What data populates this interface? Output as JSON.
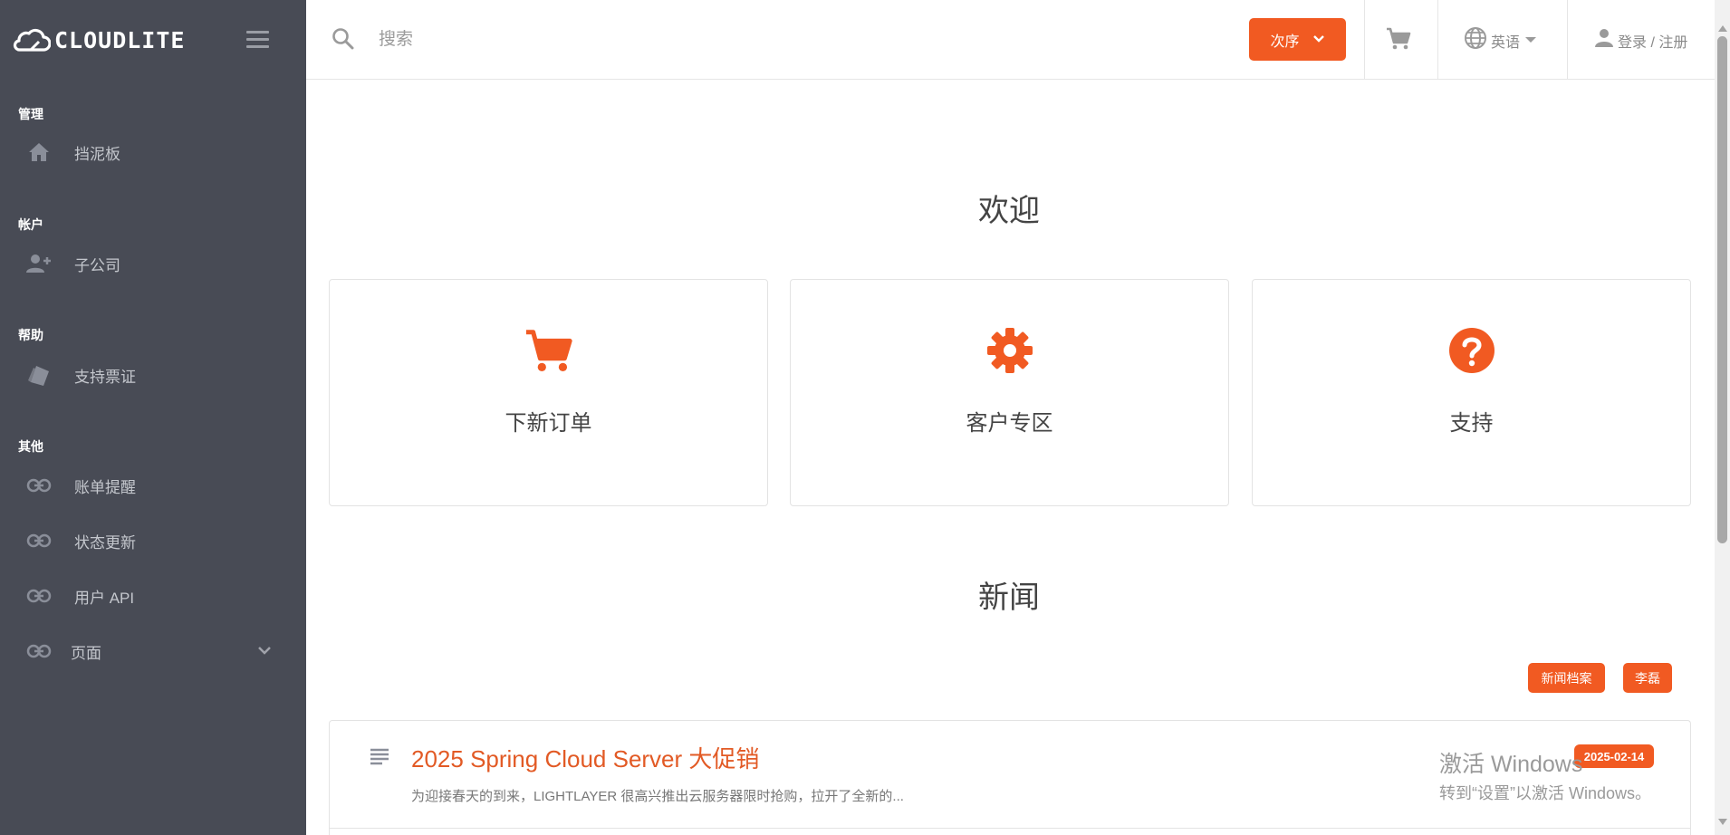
{
  "brand": {
    "logo_text": "CLOUDLITE"
  },
  "sidebar": {
    "sections": [
      {
        "title": "管理",
        "items": [
          {
            "label": "挡泥板",
            "icon": "home-icon"
          }
        ]
      },
      {
        "title": "帐户",
        "items": [
          {
            "label": "子公司",
            "icon": "user-plus-icon"
          }
        ]
      },
      {
        "title": "帮助",
        "items": [
          {
            "label": "支持票证",
            "icon": "ticket-icon"
          }
        ]
      },
      {
        "title": "其他",
        "items": [
          {
            "label": "账单提醒",
            "icon": "link-icon"
          },
          {
            "label": "状态更新",
            "icon": "link-icon"
          },
          {
            "label": "用户 API",
            "icon": "link-icon"
          },
          {
            "label": "页面",
            "icon": "link-icon"
          }
        ]
      }
    ]
  },
  "topbar": {
    "search_placeholder": "搜索",
    "order_label": "次序",
    "language_label": "英语",
    "login_label": "登录 / 注册"
  },
  "main": {
    "welcome_title": "欢迎",
    "cards": [
      {
        "label": "下新订单",
        "icon": "cart-icon"
      },
      {
        "label": "客户专区",
        "icon": "gear-icon"
      },
      {
        "label": "支持",
        "icon": "help-icon"
      }
    ],
    "news_title": "新闻",
    "news_archive_label": "新闻档案",
    "news_author_label": "李磊",
    "news_items": [
      {
        "title": "2025 Spring Cloud Server 大促销",
        "summary": "为迎接春天的到来，LIGHTLAYER 很高兴推出云服务器限时抢购，拉开了全新的...",
        "date": "2025-02-14"
      }
    ]
  },
  "watermark": {
    "line1": "激活 Windows",
    "line2": "转到“设置”以激活 Windows。"
  },
  "colors": {
    "accent": "#f15a22",
    "sidebar_bg": "#484b55"
  }
}
